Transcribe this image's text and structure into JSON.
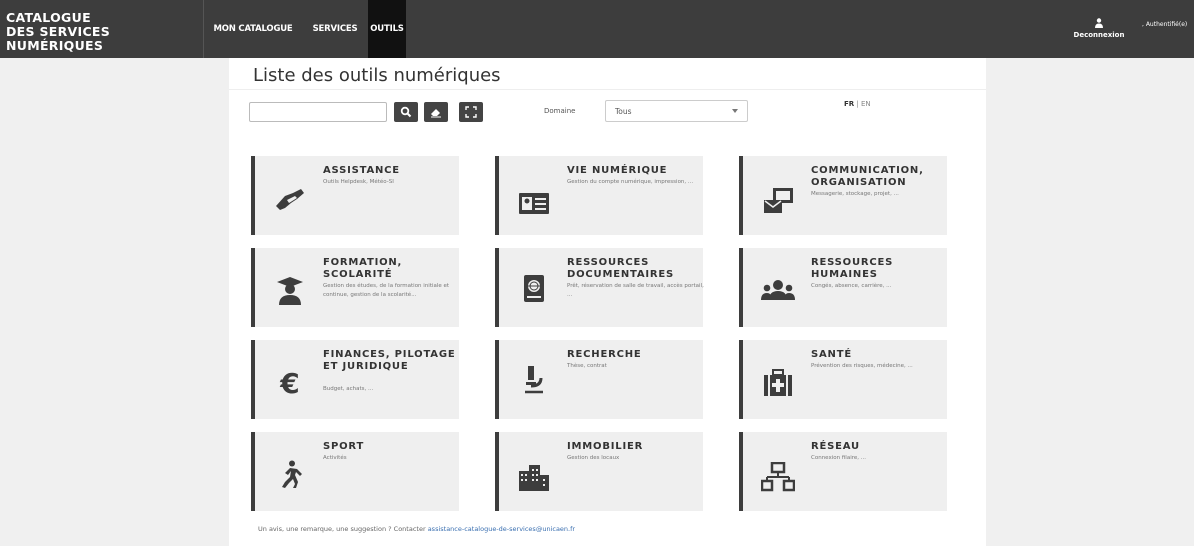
{
  "header": {
    "brand_line1": "CATALOGUE",
    "brand_line2": "DES SERVICES NUMÉRIQUES",
    "nav": [
      "MON CATALOGUE",
      "SERVICES",
      "OUTILS"
    ],
    "logout": "Deconnexion",
    "user": ", Authentifié(e)"
  },
  "main": {
    "title": "Liste des outils numériques",
    "search_value": "",
    "domain_label": "Domaine",
    "domain_value": "Tous",
    "lang_fr": "FR",
    "lang_sep": "|",
    "lang_en": "EN"
  },
  "cards": [
    {
      "title": "ASSISTANCE",
      "desc": "Outils Helpdesk, Météo-SI",
      "icon": "handshake-icon"
    },
    {
      "title": "VIE NUMÉRIQUE",
      "desc": "Gestion du compte numérique, impression, ...",
      "icon": "id-card-icon"
    },
    {
      "title": "COMMUNICATION, ORGANISATION",
      "desc": "Messagerie, stockage, projet, ...",
      "icon": "envelope-monitor-icon"
    },
    {
      "title": "FORMATION, SCOLARITÉ",
      "desc": "Gestion des études, de la formation initiale et continue, gestion de la scolarité...",
      "icon": "graduate-icon"
    },
    {
      "title": "RESSOURCES DOCUMENTAIRES",
      "desc": "Prêt, réservation de salle de travail, accès portail, ...",
      "icon": "book-globe-icon"
    },
    {
      "title": "RESSOURCES HUMAINES",
      "desc": "Congés, absence, carrière, ...",
      "icon": "users-icon"
    },
    {
      "title": "FINANCES, PILOTAGE ET JURIDIQUE",
      "desc": "Budget, achats, ...",
      "icon": "euro-icon"
    },
    {
      "title": "RECHERCHE",
      "desc": "Thèse, contrat",
      "icon": "microscope-icon"
    },
    {
      "title": "SANTÉ",
      "desc": "Prévention des risques, médecine, ...",
      "icon": "medkit-icon"
    },
    {
      "title": "SPORT",
      "desc": "Activités",
      "icon": "running-icon"
    },
    {
      "title": "IMMOBILIER",
      "desc": "Gestion des locaux",
      "icon": "buildings-icon"
    },
    {
      "title": "RÉSEAU",
      "desc": "Connexion filaire, ...",
      "icon": "network-icon"
    }
  ],
  "footer": {
    "text": "Un avis, une remarque, une suggestion ? Contacter ",
    "email": "assistance-catalogue-de-services@unicaen.fr"
  }
}
